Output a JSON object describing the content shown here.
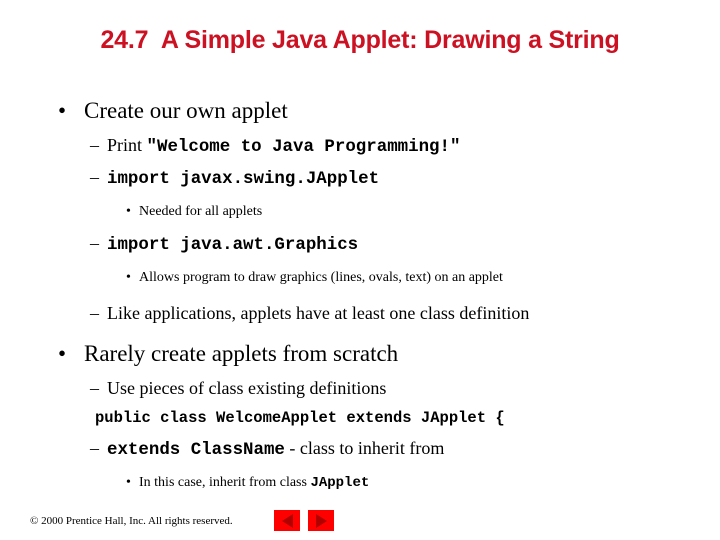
{
  "slide": {
    "title": "24.7  A Simple Java Applet: Drawing a String",
    "title_color": "#cc1122",
    "background_color": "#ffffff"
  },
  "bullets": {
    "b1_mark": "•",
    "b1_text": "Create our own applet",
    "b2_mark": "–",
    "b2_print_label": "Print ",
    "b2_print_code": "\"Welcome to Java Programming!\"",
    "b3_mark": "–",
    "b3_code": "import javax.swing.JApplet",
    "b4_mark": "•",
    "b4_text": "Needed for all applets",
    "b5_mark": "–",
    "b5_code": "import java.awt.Graphics",
    "b6_mark": "•",
    "b6_text": "Allows program to draw graphics (lines, ovals, text) on an applet",
    "b7_mark": "–",
    "b7_text": "Like applications, applets have at least one class definition",
    "b8_mark": "•",
    "b8_text": "Rarely create applets from scratch",
    "b9_mark": "–",
    "b9_text": "Use pieces of class existing definitions",
    "b10_code": "public class WelcomeApplet extends JApplet {",
    "b11_mark": "–",
    "b11_code": "extends ClassName",
    "b11_suffix": " - class to inherit from",
    "b12_mark": "•",
    "b12_prefix": "In this case, inherit from class ",
    "b12_code": "JApplet"
  },
  "footer": {
    "copyright": "© 2000 Prentice Hall, Inc.  All rights reserved.",
    "prev_icon": "triangle-left-icon",
    "next_icon": "triangle-right-icon",
    "button_color": "#ff0000",
    "triangle_color": "#b00000"
  }
}
